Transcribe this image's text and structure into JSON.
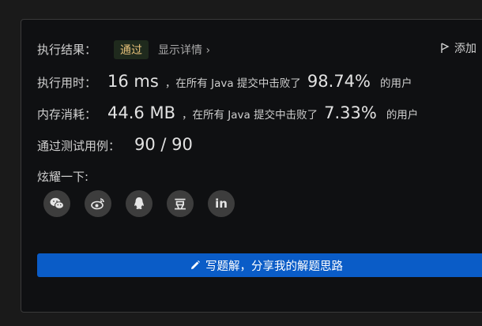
{
  "result": {
    "label": "执行结果：",
    "status": "通过",
    "detail_link": "显示详情",
    "add_label": "添加"
  },
  "runtime": {
    "label": "执行用时：",
    "value": "16 ms",
    "middle": "，在所有 Java 提交中击败了",
    "percent": "98.74%",
    "suffix": "的用户"
  },
  "memory": {
    "label": "内存消耗：",
    "value": "44.6 MB",
    "middle": "，在所有 Java 提交中击败了",
    "percent": "7.33%",
    "suffix": "的用户"
  },
  "testcases": {
    "label": "通过测试用例：",
    "value": "90 / 90"
  },
  "share_section": {
    "label": "炫耀一下:",
    "icons": [
      "wechat-icon",
      "weibo-icon",
      "qq-icon",
      "douban-icon",
      "linkedin-icon"
    ],
    "douban_glyph": "豆",
    "linkedin_glyph": "in"
  },
  "share_button": {
    "label": "写题解，分享我的解题思路"
  },
  "colors": {
    "background": "#1a1a1a",
    "card": "#0f1012",
    "badge_text": "#e8c27a",
    "button": "#0a5cc7"
  }
}
